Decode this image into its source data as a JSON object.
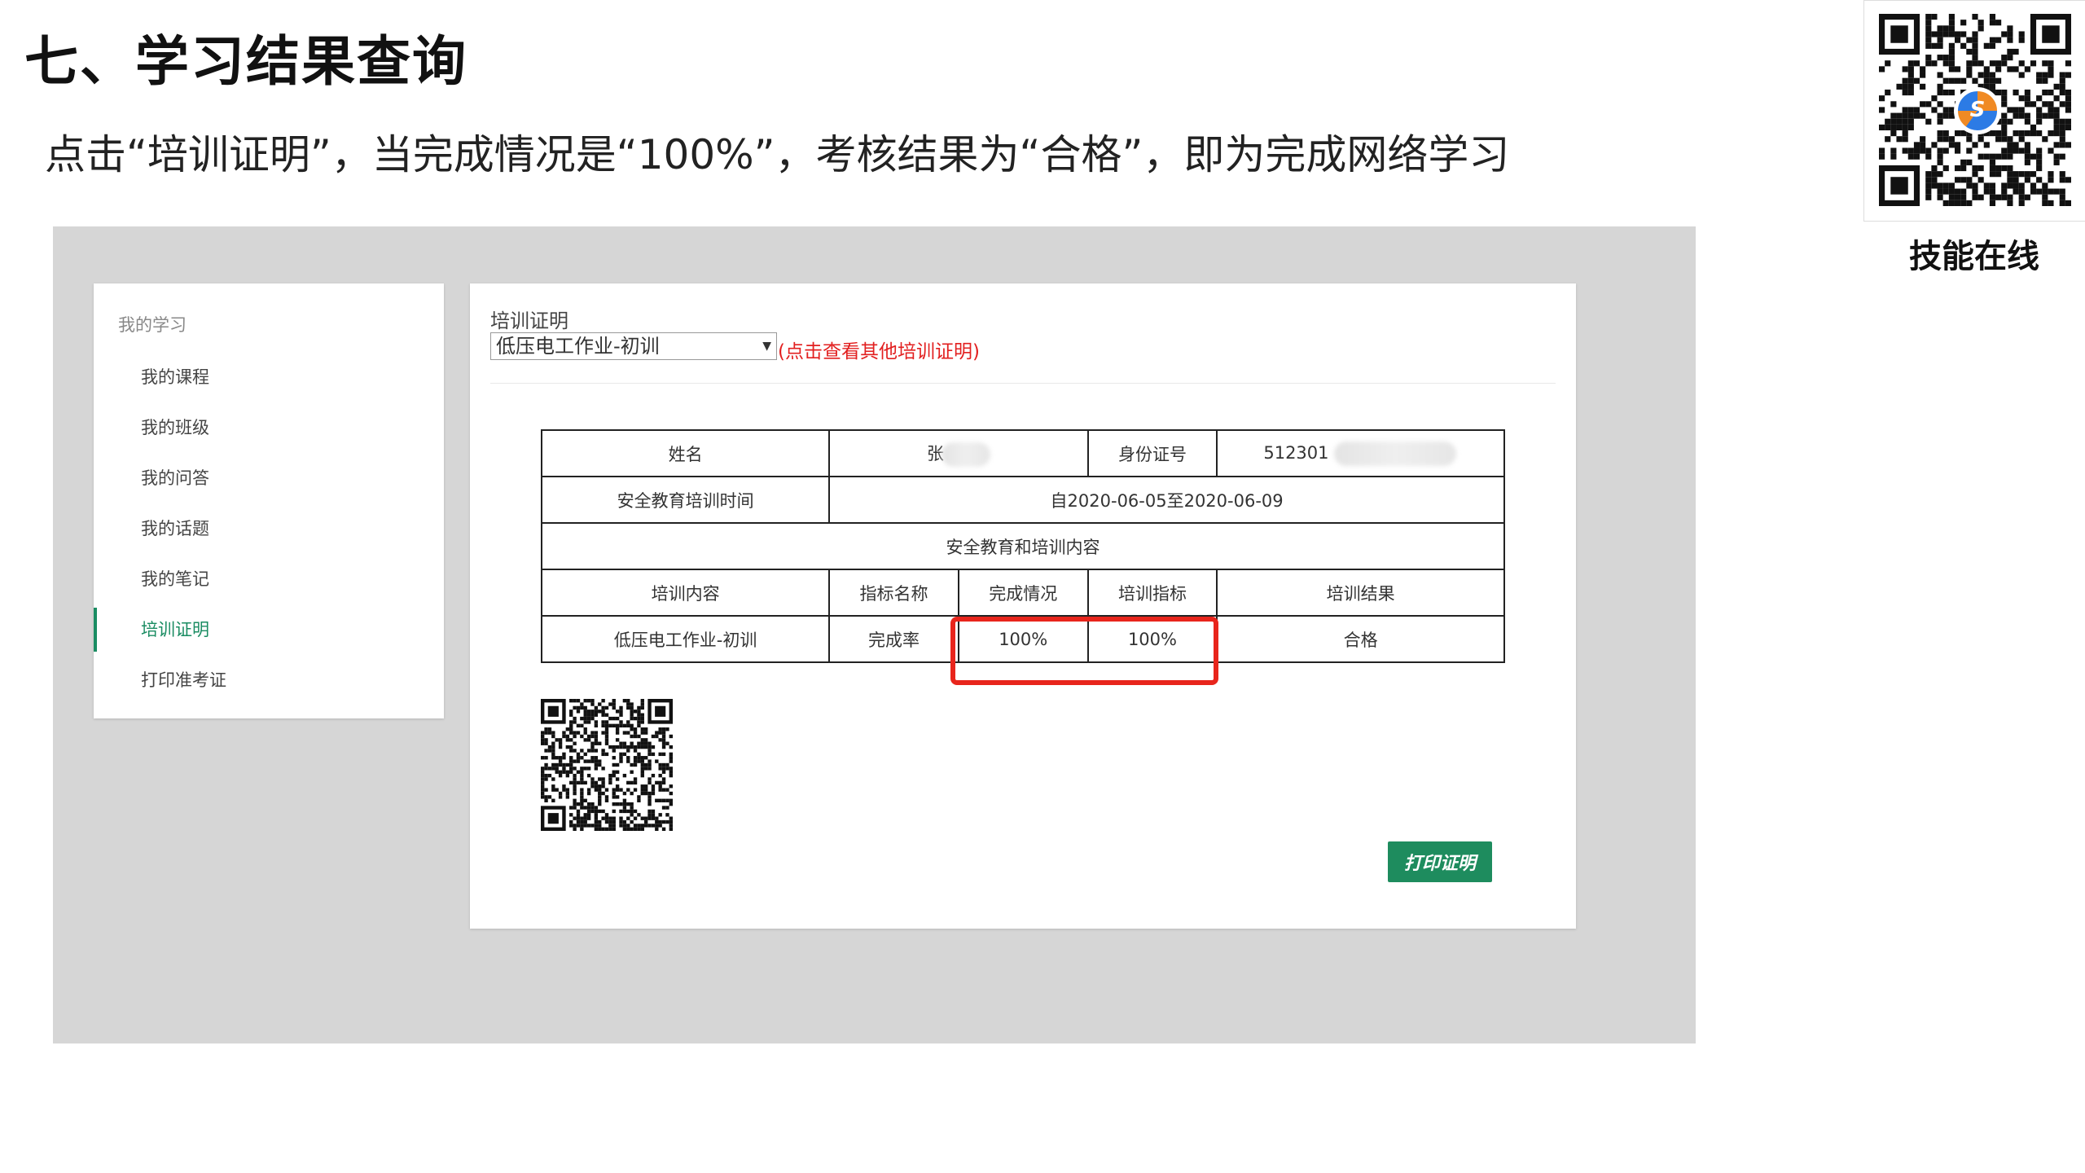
{
  "slide": {
    "title": "七、学习结果查询",
    "subtitle": "点击“培训证明”，当完成情况是“100%”，考核结果为“合格”，即为完成网络学习",
    "qr_caption": "技能在线"
  },
  "sidebar": {
    "heading": "我的学习",
    "items": [
      {
        "label": "我的课程"
      },
      {
        "label": "我的班级"
      },
      {
        "label": "我的问答"
      },
      {
        "label": "我的话题"
      },
      {
        "label": "我的笔记"
      },
      {
        "label": "培训证明",
        "active": true
      },
      {
        "label": "打印准考证"
      }
    ]
  },
  "main": {
    "title": "培训证明",
    "select_value": "低压电工作业-初训",
    "select_hint": "(点击查看其他培训证明)",
    "print_button": "打印证明"
  },
  "certificate": {
    "name_label": "姓名",
    "name_value": "张",
    "id_label": "身份证号",
    "id_value": "512301",
    "period_label": "安全教育培训时间",
    "period_value": "自2020-06-05至2020-06-09",
    "section_label": "安全教育和培训内容",
    "headers": [
      "培训内容",
      "指标名称",
      "完成情况",
      "培训指标",
      "培训结果"
    ],
    "row": [
      "低压电工作业-初训",
      "完成率",
      "100%",
      "100%",
      "合格"
    ]
  },
  "colors": {
    "accent_green": "#1a8c62",
    "highlight_red": "#e8251c",
    "hint_red": "#e21f1f"
  }
}
